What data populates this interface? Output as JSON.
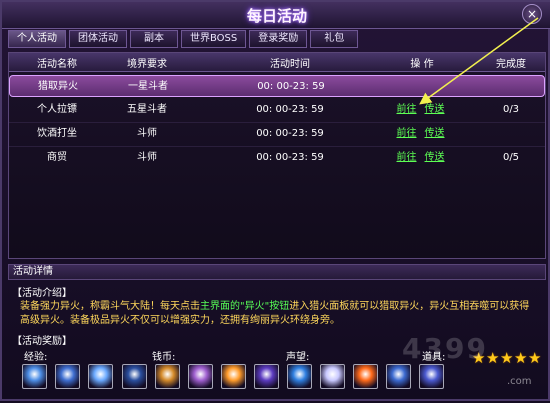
{
  "window": {
    "title": "每日活动",
    "close_label": "×"
  },
  "tabs": [
    {
      "label": "个人活动"
    },
    {
      "label": "团体活动"
    },
    {
      "label": "副本"
    },
    {
      "label": "世界BOSS"
    },
    {
      "label": "登录奖励"
    },
    {
      "label": "礼包"
    }
  ],
  "table": {
    "headers": [
      "活动名称",
      "境界要求",
      "活动时间",
      "操 作",
      "完成度"
    ],
    "rows": [
      {
        "name": "猎取异火",
        "level": "一星斗者",
        "time": "00: 00-23: 59",
        "op1": "",
        "op2": "",
        "progress": ""
      },
      {
        "name": "个人拉镖",
        "level": "五星斗者",
        "time": "00: 00-23: 59",
        "op1": "前往",
        "op2": "传送",
        "progress": "0/3"
      },
      {
        "name": "饮酒打坐",
        "level": "斗师",
        "time": "00: 00-23: 59",
        "op1": "前往",
        "op2": "传送",
        "progress": ""
      },
      {
        "name": "商贸",
        "level": "斗师",
        "time": "00: 00-23: 59",
        "op1": "前往",
        "op2": "传送",
        "progress": "0/5"
      }
    ]
  },
  "details": {
    "header": "活动详情",
    "intro_title": "【活动介绍】",
    "intro_prefix": "装备强力异火，称霸斗气大陆！每天点击",
    "intro_highlight_1": "主界面的\"异火\"按钮",
    "intro_mid": "进入猎火面板就可以猎取异火，异火互相吞噬可以获得高级异火。装备极品异火不仅可以增强实力，还拥有绚丽异火环绕身旁。",
    "reward_title": "【活动奖励】",
    "reward_labels": {
      "exp": "经验:",
      "money": "钱币:",
      "fame": "声望:",
      "item": "道具:"
    },
    "item_star_count": 5
  },
  "reward_icons": [
    {
      "name": "exp-orb-1",
      "color": "#4d8ee6"
    },
    {
      "name": "exp-orb-2",
      "color": "#3f6fd1"
    },
    {
      "name": "exp-orb-3",
      "color": "#6aa9ff"
    },
    {
      "name": "exp-orb-4",
      "color": "#2a4f9f"
    },
    {
      "name": "money-orb-1",
      "color": "#d48a2a"
    },
    {
      "name": "money-orb-2",
      "color": "#a060d0"
    },
    {
      "name": "money-orb-3",
      "color": "#ff9b2a"
    },
    {
      "name": "money-orb-4",
      "color": "#5c3cc0"
    },
    {
      "name": "fame-orb-1",
      "color": "#2f7fe0"
    },
    {
      "name": "fame-orb-2",
      "color": "#c9c9ff"
    },
    {
      "name": "fame-orb-3",
      "color": "#ff6a1a"
    },
    {
      "name": "fame-orb-4",
      "color": "#3c6bd1"
    },
    {
      "name": "fame-orb-5",
      "color": "#4b5ad0"
    }
  ],
  "watermark": {
    "big": "4399",
    "small": ".com"
  }
}
